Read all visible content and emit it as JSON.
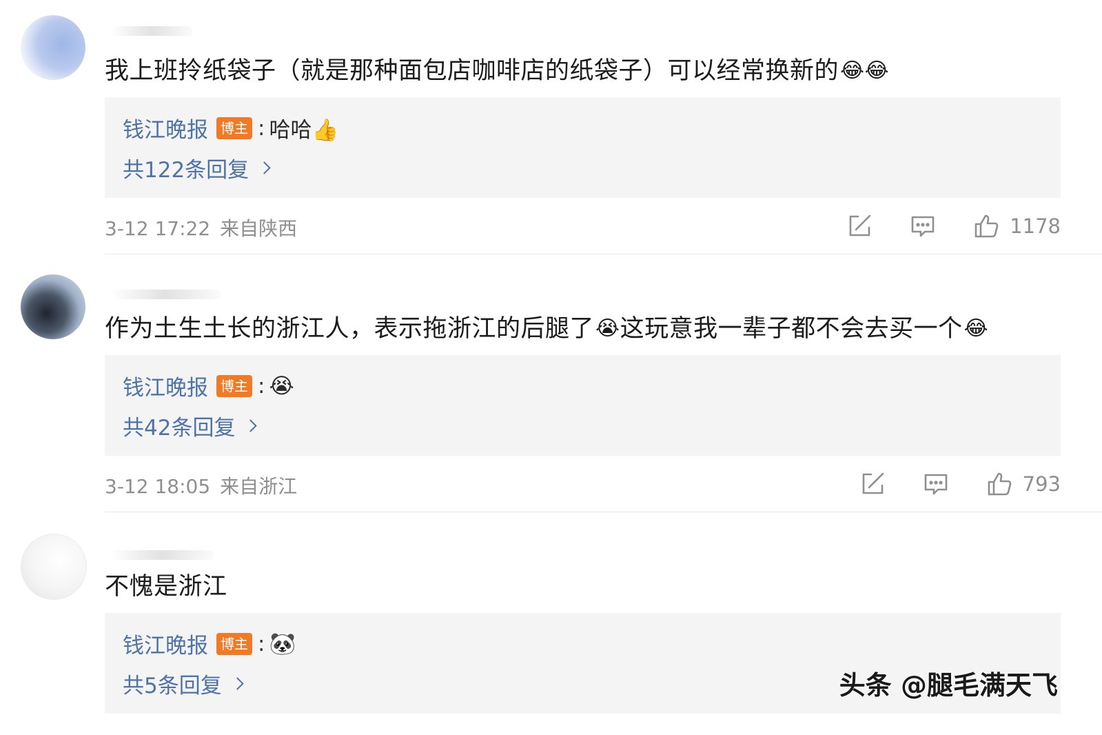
{
  "comments": [
    {
      "text": "我上班拎纸袋子（就是那种面包店咖啡店的纸袋子）可以经常换新的",
      "emojis": "😂😂",
      "reply": {
        "author": "钱江晚报",
        "badge": "博主",
        "colon": ":",
        "content": "哈哈👍",
        "count_label": "共122条回复"
      },
      "time": "3-12 17:22",
      "location": "来自陕西",
      "likes": "1178"
    },
    {
      "text_a": "作为土生土长的浙江人，表示拖浙江的后腿了",
      "emoji_a": "😭",
      "text_b": "这玩意我一辈子都不会去买一个",
      "emoji_b": "😂",
      "reply": {
        "author": "钱江晚报",
        "badge": "博主",
        "colon": ":",
        "content": "😭",
        "count_label": "共42条回复"
      },
      "time": "3-12 18:05",
      "location": "来自浙江",
      "likes": "793"
    },
    {
      "text": "不愧是浙江",
      "reply": {
        "author": "钱江晚报",
        "badge": "博主",
        "colon": ":",
        "content": "🐼",
        "count_label": "共5条回复"
      }
    }
  ],
  "icons": {
    "share": "share-icon",
    "comment": "comment-icon",
    "like": "thumbs-up-icon",
    "chevron": "chevron-right-icon"
  },
  "colors": {
    "link": "#4f73a6",
    "badge": "#f07a26",
    "reply_bg": "#f4f4f4",
    "meta": "#8f8f8f"
  },
  "watermark": "头条 @腿毛满天飞"
}
